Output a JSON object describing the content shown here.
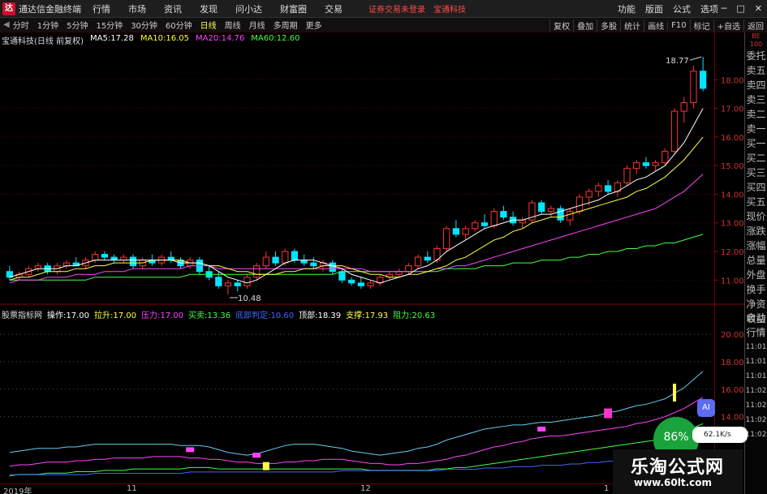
{
  "app": {
    "title": "通达信金融终端",
    "logo_glyph": "达",
    "menu": [
      "行情",
      "市场",
      "资讯",
      "发现",
      "问小达",
      "财富圈",
      "交易"
    ],
    "notice": "证券交易未登录",
    "stock_name": "宝通科技",
    "right_menu": [
      "功能",
      "版面",
      "公式",
      "选项"
    ],
    "window_controls": [
      "─",
      "□",
      "✕"
    ]
  },
  "periods": {
    "items": [
      "分时",
      "1分钟",
      "5分钟",
      "15分钟",
      "30分钟",
      "60分钟",
      "日线",
      "周线",
      "月线",
      "多周期",
      "更多"
    ],
    "active_index": 6,
    "tools": [
      "复权",
      "叠加",
      "多股",
      "统计",
      "画线",
      "F10",
      "标记",
      "+自选",
      "返回"
    ]
  },
  "chart": {
    "header": "宝通科技(日线 前复权)",
    "ma": [
      {
        "label": "MA5:",
        "value": "17.28",
        "color": "#ffffff"
      },
      {
        "label": "MA10:",
        "value": "16.05",
        "color": "#ffff44"
      },
      {
        "label": "MA20:",
        "value": "14.76",
        "color": "#ff44ff"
      },
      {
        "label": "MA60:",
        "value": "12.60",
        "color": "#44ff44"
      }
    ],
    "high_label": "18.77",
    "low_label": "10.48",
    "price_ticks": [
      "18.00",
      "17.00",
      "16.00",
      "15.00",
      "14.00",
      "13.00",
      "12.00",
      "11.00"
    ]
  },
  "indicator": {
    "name": "股票指标网",
    "params": [
      {
        "label": "操作:",
        "value": "17.00",
        "color": "#ffffff"
      },
      {
        "label": "拉升:",
        "value": "17.00",
        "color": "#ffff44"
      },
      {
        "label": "压力:",
        "value": "17.00",
        "color": "#ff44ff"
      },
      {
        "label": "买卖:",
        "value": "13.36",
        "color": "#44ff44"
      },
      {
        "label": "底部判定:",
        "value": "10.60",
        "color": "#4466ff"
      },
      {
        "label": "顶部:",
        "value": "18.39",
        "color": "#ffffff"
      },
      {
        "label": "支撑:",
        "value": "17.93",
        "color": "#ffff44"
      },
      {
        "label": "阻力:",
        "value": "20.63",
        "color": "#44ff44"
      }
    ],
    "ticks": [
      "20.00",
      "18.00",
      "16.00",
      "14.00"
    ]
  },
  "side_panel": {
    "top_small": [
      "BE",
      "100"
    ],
    "items": [
      "委托",
      "卖五",
      "卖四",
      "卖三",
      "卖二",
      "卖一",
      "买一",
      "买二",
      "买三",
      "买四",
      "买五",
      "现价",
      "涨跌",
      "涨幅",
      "总量",
      "外盘",
      "换手",
      "净资",
      "收益"
    ],
    "lower_items": [
      "自动",
      "行情",
      "11:01",
      "11:01",
      "11:01",
      "11:02",
      "11:02",
      "11:02",
      "11:02"
    ]
  },
  "dates": [
    "2019年",
    "11",
    "12",
    "1"
  ],
  "watermark": {
    "line1": "乐淘公式网",
    "line2": "www.60lt.com"
  },
  "overlay": {
    "ai": "AI",
    "speed": "62.1K/s",
    "percent": "86%"
  },
  "colors": {
    "up": "#ff3333",
    "down": "#00e5ff",
    "ma5": "#ffffff",
    "ma10": "#ffff44",
    "ma20": "#ff44ff",
    "ma60": "#44ff44"
  },
  "chart_data": {
    "type": "candlestick",
    "title": "宝通科技(日线 前复权)",
    "ylim": [
      10.3,
      19.2
    ],
    "candles": [
      [
        11.3,
        11.5,
        11.0,
        11.1
      ],
      [
        11.1,
        11.3,
        11.0,
        11.2
      ],
      [
        11.2,
        11.5,
        11.1,
        11.4
      ],
      [
        11.4,
        11.6,
        11.3,
        11.5
      ],
      [
        11.5,
        11.6,
        11.2,
        11.3
      ],
      [
        11.3,
        11.6,
        11.2,
        11.5
      ],
      [
        11.5,
        11.7,
        11.4,
        11.6
      ],
      [
        11.6,
        11.8,
        11.5,
        11.5
      ],
      [
        11.5,
        11.8,
        11.4,
        11.7
      ],
      [
        11.7,
        12.0,
        11.6,
        11.9
      ],
      [
        11.9,
        12.0,
        11.7,
        11.8
      ],
      [
        11.8,
        11.9,
        11.6,
        11.7
      ],
      [
        11.7,
        11.9,
        11.6,
        11.8
      ],
      [
        11.8,
        11.9,
        11.4,
        11.5
      ],
      [
        11.5,
        11.8,
        11.4,
        11.7
      ],
      [
        11.7,
        11.9,
        11.5,
        11.6
      ],
      [
        11.6,
        11.9,
        11.5,
        11.8
      ],
      [
        11.8,
        12.0,
        11.6,
        11.7
      ],
      [
        11.7,
        11.8,
        11.4,
        11.5
      ],
      [
        11.5,
        11.8,
        11.4,
        11.7
      ],
      [
        11.7,
        11.8,
        11.2,
        11.3
      ],
      [
        11.3,
        11.5,
        11.0,
        11.1
      ],
      [
        11.1,
        11.3,
        10.7,
        10.8
      ],
      [
        10.8,
        11.0,
        10.5,
        10.9
      ],
      [
        10.9,
        11.0,
        10.6,
        10.8
      ],
      [
        10.8,
        11.2,
        10.7,
        11.1
      ],
      [
        11.1,
        11.6,
        11.0,
        11.5
      ],
      [
        11.5,
        12.0,
        11.4,
        11.8
      ],
      [
        11.8,
        12.0,
        11.5,
        11.6
      ],
      [
        11.6,
        12.1,
        11.5,
        12.0
      ],
      [
        12.0,
        12.1,
        11.6,
        11.7
      ],
      [
        11.7,
        11.9,
        11.5,
        11.6
      ],
      [
        11.6,
        11.8,
        11.4,
        11.5
      ],
      [
        11.5,
        11.7,
        11.3,
        11.6
      ],
      [
        11.6,
        11.7,
        11.2,
        11.3
      ],
      [
        11.3,
        11.4,
        10.9,
        11.0
      ],
      [
        11.0,
        11.1,
        10.8,
        10.9
      ],
      [
        10.9,
        11.1,
        10.7,
        10.8
      ],
      [
        10.8,
        11.0,
        10.7,
        10.9
      ],
      [
        10.9,
        11.2,
        10.8,
        11.1
      ],
      [
        11.1,
        11.3,
        11.0,
        11.2
      ],
      [
        11.2,
        11.4,
        11.1,
        11.3
      ],
      [
        11.3,
        11.6,
        11.2,
        11.5
      ],
      [
        11.5,
        11.9,
        11.4,
        11.8
      ],
      [
        11.8,
        12.0,
        11.6,
        11.7
      ],
      [
        11.7,
        12.2,
        11.6,
        12.1
      ],
      [
        12.1,
        12.9,
        12.0,
        12.8
      ],
      [
        12.8,
        13.1,
        12.5,
        12.6
      ],
      [
        12.6,
        12.9,
        12.4,
        12.8
      ],
      [
        12.8,
        13.1,
        12.7,
        13.0
      ],
      [
        13.0,
        13.3,
        12.8,
        12.9
      ],
      [
        12.9,
        13.5,
        12.8,
        13.4
      ],
      [
        13.4,
        13.6,
        13.1,
        13.2
      ],
      [
        13.2,
        13.4,
        12.9,
        13.0
      ],
      [
        13.0,
        13.2,
        12.8,
        13.1
      ],
      [
        13.1,
        13.8,
        13.0,
        13.7
      ],
      [
        13.7,
        13.8,
        13.3,
        13.4
      ],
      [
        13.4,
        13.6,
        13.2,
        13.5
      ],
      [
        13.5,
        13.6,
        13.0,
        13.1
      ],
      [
        13.1,
        13.5,
        12.9,
        13.4
      ],
      [
        13.4,
        14.0,
        13.3,
        13.9
      ],
      [
        13.9,
        14.2,
        13.6,
        14.1
      ],
      [
        14.1,
        14.4,
        13.9,
        14.3
      ],
      [
        14.3,
        14.5,
        14.0,
        14.1
      ],
      [
        14.1,
        14.5,
        13.9,
        14.4
      ],
      [
        14.4,
        15.0,
        14.3,
        14.9
      ],
      [
        14.9,
        15.2,
        14.7,
        15.1
      ],
      [
        15.1,
        15.3,
        14.9,
        15.0
      ],
      [
        15.0,
        15.2,
        14.8,
        15.1
      ],
      [
        15.1,
        15.6,
        15.0,
        15.5
      ],
      [
        15.5,
        17.0,
        15.4,
        16.9
      ],
      [
        16.9,
        17.4,
        16.5,
        17.2
      ],
      [
        17.2,
        18.5,
        17.0,
        18.3
      ],
      [
        18.3,
        18.8,
        17.6,
        17.7
      ]
    ],
    "ma5": [
      11.1,
      11.2,
      11.3,
      11.4,
      11.4,
      11.4,
      11.5,
      11.5,
      11.6,
      11.7,
      11.7,
      11.7,
      11.7,
      11.7,
      11.7,
      11.7,
      11.7,
      11.7,
      11.6,
      11.6,
      11.6,
      11.5,
      11.3,
      11.1,
      11.0,
      10.9,
      11.0,
      11.2,
      11.4,
      11.6,
      11.7,
      11.7,
      11.7,
      11.6,
      11.5,
      11.4,
      11.2,
      11.1,
      11.0,
      10.9,
      11.0,
      11.1,
      11.2,
      11.4,
      11.5,
      11.7,
      12.0,
      12.2,
      12.4,
      12.6,
      12.8,
      12.9,
      13.0,
      13.1,
      13.1,
      13.2,
      13.3,
      13.3,
      13.4,
      13.5,
      13.6,
      13.7,
      13.8,
      14.0,
      14.1,
      14.3,
      14.5,
      14.6,
      14.8,
      15.0,
      15.4,
      15.8,
      16.4,
      17.0
    ],
    "ma10": [
      11.0,
      11.1,
      11.1,
      11.2,
      11.3,
      11.3,
      11.3,
      11.4,
      11.4,
      11.5,
      11.5,
      11.6,
      11.6,
      11.6,
      11.6,
      11.7,
      11.7,
      11.7,
      11.7,
      11.6,
      11.6,
      11.5,
      11.5,
      11.4,
      11.3,
      11.3,
      11.2,
      11.2,
      11.2,
      11.3,
      11.3,
      11.4,
      11.4,
      11.5,
      11.5,
      11.5,
      11.4,
      11.3,
      11.2,
      11.2,
      11.1,
      11.1,
      11.2,
      11.2,
      11.3,
      11.4,
      11.5,
      11.7,
      11.8,
      12.0,
      12.2,
      12.4,
      12.5,
      12.7,
      12.8,
      13.0,
      13.1,
      13.2,
      13.2,
      13.3,
      13.4,
      13.5,
      13.6,
      13.7,
      13.8,
      13.9,
      14.1,
      14.2,
      14.4,
      14.6,
      14.9,
      15.2,
      15.6,
      16.0
    ],
    "ma20": [
      10.9,
      11.0,
      11.0,
      11.0,
      11.1,
      11.1,
      11.1,
      11.2,
      11.2,
      11.2,
      11.3,
      11.3,
      11.3,
      11.4,
      11.4,
      11.4,
      11.4,
      11.4,
      11.4,
      11.5,
      11.5,
      11.5,
      11.4,
      11.4,
      11.4,
      11.4,
      11.4,
      11.4,
      11.4,
      11.4,
      11.4,
      11.4,
      11.4,
      11.4,
      11.4,
      11.4,
      11.4,
      11.4,
      11.3,
      11.3,
      11.3,
      11.3,
      11.3,
      11.3,
      11.3,
      11.4,
      11.4,
      11.5,
      11.5,
      11.6,
      11.7,
      11.8,
      11.9,
      12.0,
      12.1,
      12.2,
      12.3,
      12.4,
      12.5,
      12.6,
      12.7,
      12.8,
      12.9,
      13.0,
      13.1,
      13.2,
      13.3,
      13.4,
      13.5,
      13.7,
      13.9,
      14.1,
      14.4,
      14.7
    ],
    "ma60": [
      11.0,
      11.0,
      11.0,
      11.0,
      11.0,
      11.0,
      11.0,
      11.0,
      11.0,
      11.1,
      11.1,
      11.1,
      11.1,
      11.1,
      11.1,
      11.1,
      11.1,
      11.1,
      11.1,
      11.2,
      11.2,
      11.2,
      11.2,
      11.2,
      11.2,
      11.2,
      11.2,
      11.2,
      11.2,
      11.2,
      11.2,
      11.2,
      11.2,
      11.2,
      11.2,
      11.3,
      11.3,
      11.3,
      11.3,
      11.3,
      11.3,
      11.3,
      11.3,
      11.3,
      11.3,
      11.3,
      11.4,
      11.4,
      11.4,
      11.4,
      11.5,
      11.5,
      11.5,
      11.6,
      11.6,
      11.6,
      11.7,
      11.7,
      11.7,
      11.8,
      11.8,
      11.9,
      11.9,
      12.0,
      12.0,
      12.1,
      12.1,
      12.2,
      12.2,
      12.3,
      12.3,
      12.4,
      12.5,
      12.6
    ]
  }
}
